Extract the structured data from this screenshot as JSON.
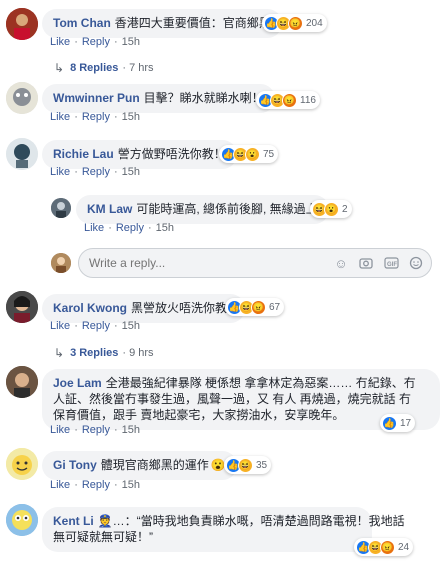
{
  "comments": [
    {
      "name": "Tom Chan",
      "text": "香港四大重要價值：官商鄉黑",
      "like": "Like",
      "reply": "Reply",
      "time": "15h",
      "reactions": [
        "like",
        "haha",
        "angry"
      ],
      "count": "204"
    },
    {
      "name": "Wmwinner Pun",
      "text": "目擊？睇水就睇水喇！",
      "like": "Like",
      "reply": "Reply",
      "time": "15h",
      "reactions": [
        "like",
        "haha",
        "angry"
      ],
      "count": "116"
    },
    {
      "name": "Richie Lau",
      "text": "謍方做野唔洗你教！",
      "like": "Like",
      "reply": "Reply",
      "time": "15h",
      "reactions": [
        "like",
        "haha",
        "wow"
      ],
      "count": "75"
    },
    {
      "name": "Karol Kwong",
      "text": "黑謍放火唔洗你教?",
      "like": "Like",
      "reply": "Reply",
      "time": "15h",
      "reactions": [
        "like",
        "haha",
        "angry"
      ],
      "count": "67"
    },
    {
      "name": "Joe Lam",
      "text_line1": "全港最強紀律暴隊 梗係想 拿拿林定為惡案…… 冇紀錄、冇",
      "text_line2": "人証、然後當冇事發生過，風聲一過，又 有人 再燒過，燒完就話 冇",
      "text_line3": "保育價值，跟手 賣地起豪宅，大家撈油水，安享晚年。",
      "like": "Like",
      "reply": "Reply",
      "time": "15h",
      "reactions": [
        "like"
      ],
      "count": "17"
    },
    {
      "name": "Gi Tony",
      "text": "體現官商鄉黑的運作",
      "like": "Like",
      "reply": "Reply",
      "time": "15h",
      "reactions": [
        "like",
        "haha"
      ],
      "count": "35"
    },
    {
      "name": "Kent Li",
      "text_line1": "…：“當時我地負責睇水嘅，唔清楚過問路電視！我地話",
      "text_line2": "無可疑就無可疑！”",
      "like": "Like",
      "reply": "Reply",
      "time": "15h",
      "reactions": [
        "like",
        "haha",
        "angry"
      ],
      "count": "24"
    }
  ],
  "nested_reply": {
    "name": "KM Law",
    "text": "可能時運高, 總係前後腳, 無緣過上",
    "like": "Like",
    "reply": "Reply",
    "time": "15h",
    "reactions": [
      "haha",
      "wow"
    ],
    "count": "2"
  },
  "replies_links": [
    {
      "label": "8 Replies",
      "time": "· 7 hrs"
    },
    {
      "label": "3 Replies",
      "time": "· 9 hrs"
    }
  ],
  "reply_box": {
    "placeholder": "Write a reply..."
  },
  "colors": {
    "link": "#385898",
    "bubble": "#f2f3f5",
    "like": "#1877f2",
    "haha": "#f7b125",
    "angry": "#e9710f"
  }
}
